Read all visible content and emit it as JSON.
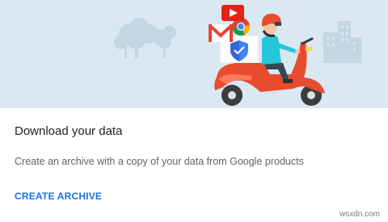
{
  "card": {
    "title": "Download your data",
    "description": "Create an archive with a copy of your data from Google products",
    "action_label": "CREATE ARCHIVE"
  },
  "hero": {
    "illustration": "scooter-delivery-illustration",
    "icons": [
      "trees-icon",
      "youtube-icon",
      "gmail-icon",
      "chrome-icon",
      "shield-icon",
      "buildings-icon"
    ]
  },
  "watermark": "wsxdn.com",
  "colors": {
    "hero_bg": "#d9e8f1",
    "accent": "#1a73e8",
    "scooter": "#e84c2f",
    "title_text": "#202124",
    "body_text": "#5f6368"
  }
}
